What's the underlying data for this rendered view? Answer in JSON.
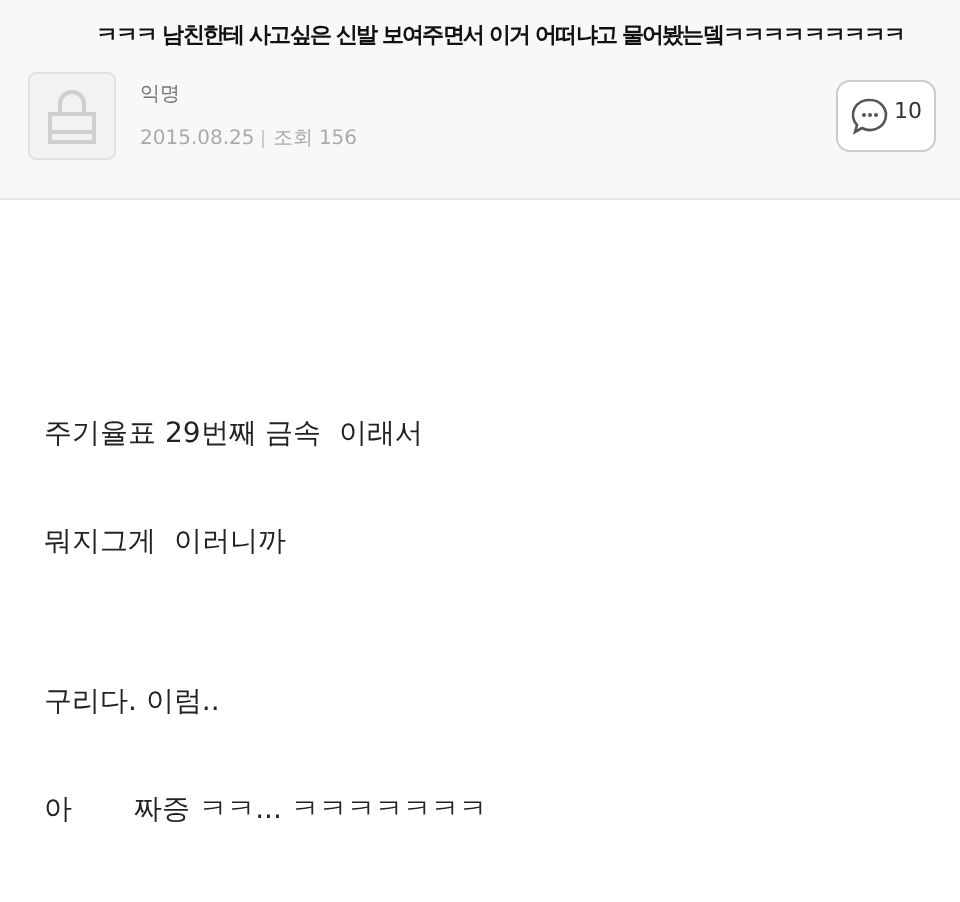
{
  "post": {
    "title": "ㅋㅋㅋ 남친한테 사고싶은 신발 보여주면서 이거 어떠냐고 물어봤는뎈ㅋㅋㅋㅋㅋㅋㅋㅋㅋ",
    "author": "익명",
    "date": "2015.08.25",
    "views": "조회 156",
    "comment_count": "10"
  },
  "body": [
    "주기율표 29번째 금속  이래서",
    "뭐지그게  이러니까",
    "구리다. 이럼..",
    "아       짜증 ㅋㅋ... ㅋㅋㅋㅋㅋㅋㅋ"
  ]
}
